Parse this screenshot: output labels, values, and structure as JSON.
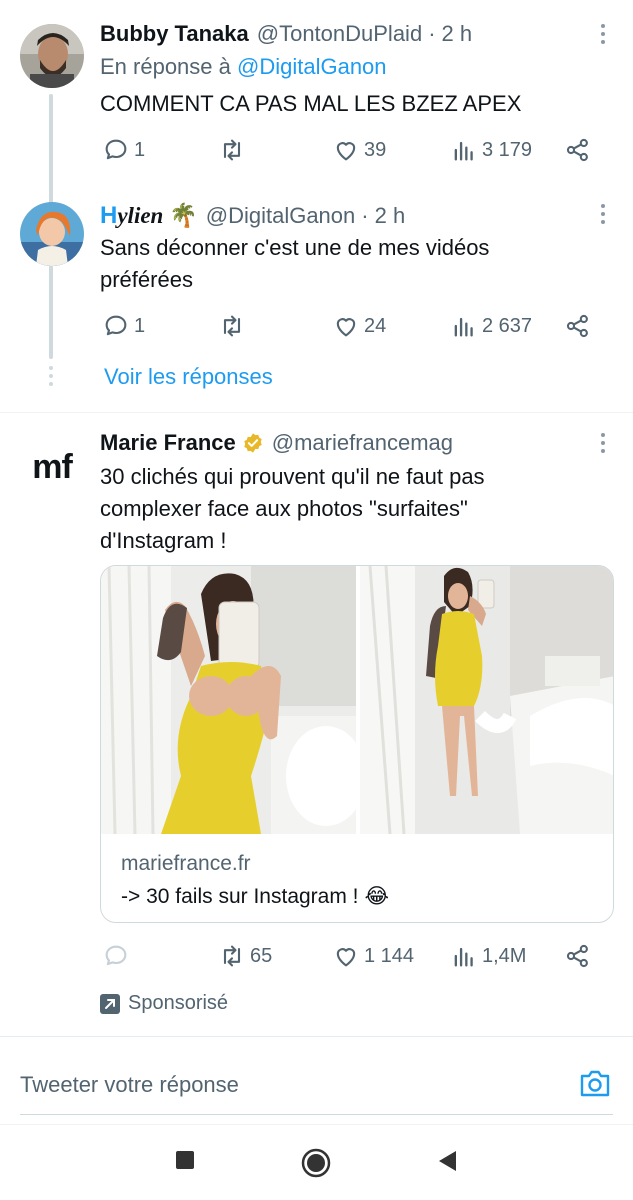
{
  "tweets": [
    {
      "name": "Bubby Tanaka",
      "handle": "@TontonDuPlaid",
      "dot": "·",
      "time": "2 h",
      "reply_prefix": "En réponse à",
      "reply_mention": "@DigitalGanon",
      "text": "COMMENT CA PAS MAL LES BZEZ APEX",
      "replies": "1",
      "retweets": "",
      "likes": "39",
      "views": "3 179"
    },
    {
      "name_first": "H",
      "name_rest": "ylien",
      "name_emoji": "🌴",
      "handle": "@DigitalGanon",
      "dot": "·",
      "time": "2 h",
      "text": "Sans déconner c'est une de mes vidéos préférées",
      "replies": "1",
      "retweets": "",
      "likes": "24",
      "views": "2 637"
    }
  ],
  "see_replies": "Voir les réponses",
  "ad": {
    "logo": "mf",
    "name": "Marie France",
    "handle": "@mariefrancemag",
    "text": "30 clichés qui prouvent qu'il ne faut pas complexer face aux photos \"surfaites\" d'Instagram !",
    "card_domain": "mariefrance.fr",
    "card_title": "-> 30 fails sur Instagram !",
    "card_emoji": "😂",
    "replies": "",
    "retweets": "65",
    "likes": "1 144",
    "views": "1,4M",
    "sponsored": "Sponsorisé"
  },
  "reply_bar": {
    "placeholder": "Tweeter votre réponse"
  },
  "colors": {
    "accent": "#1d9bf0",
    "secondary_text": "#536471",
    "border": "#cfd9de",
    "verified_gold": "#e8b829",
    "dress_yellow": "#e6cf2c"
  }
}
